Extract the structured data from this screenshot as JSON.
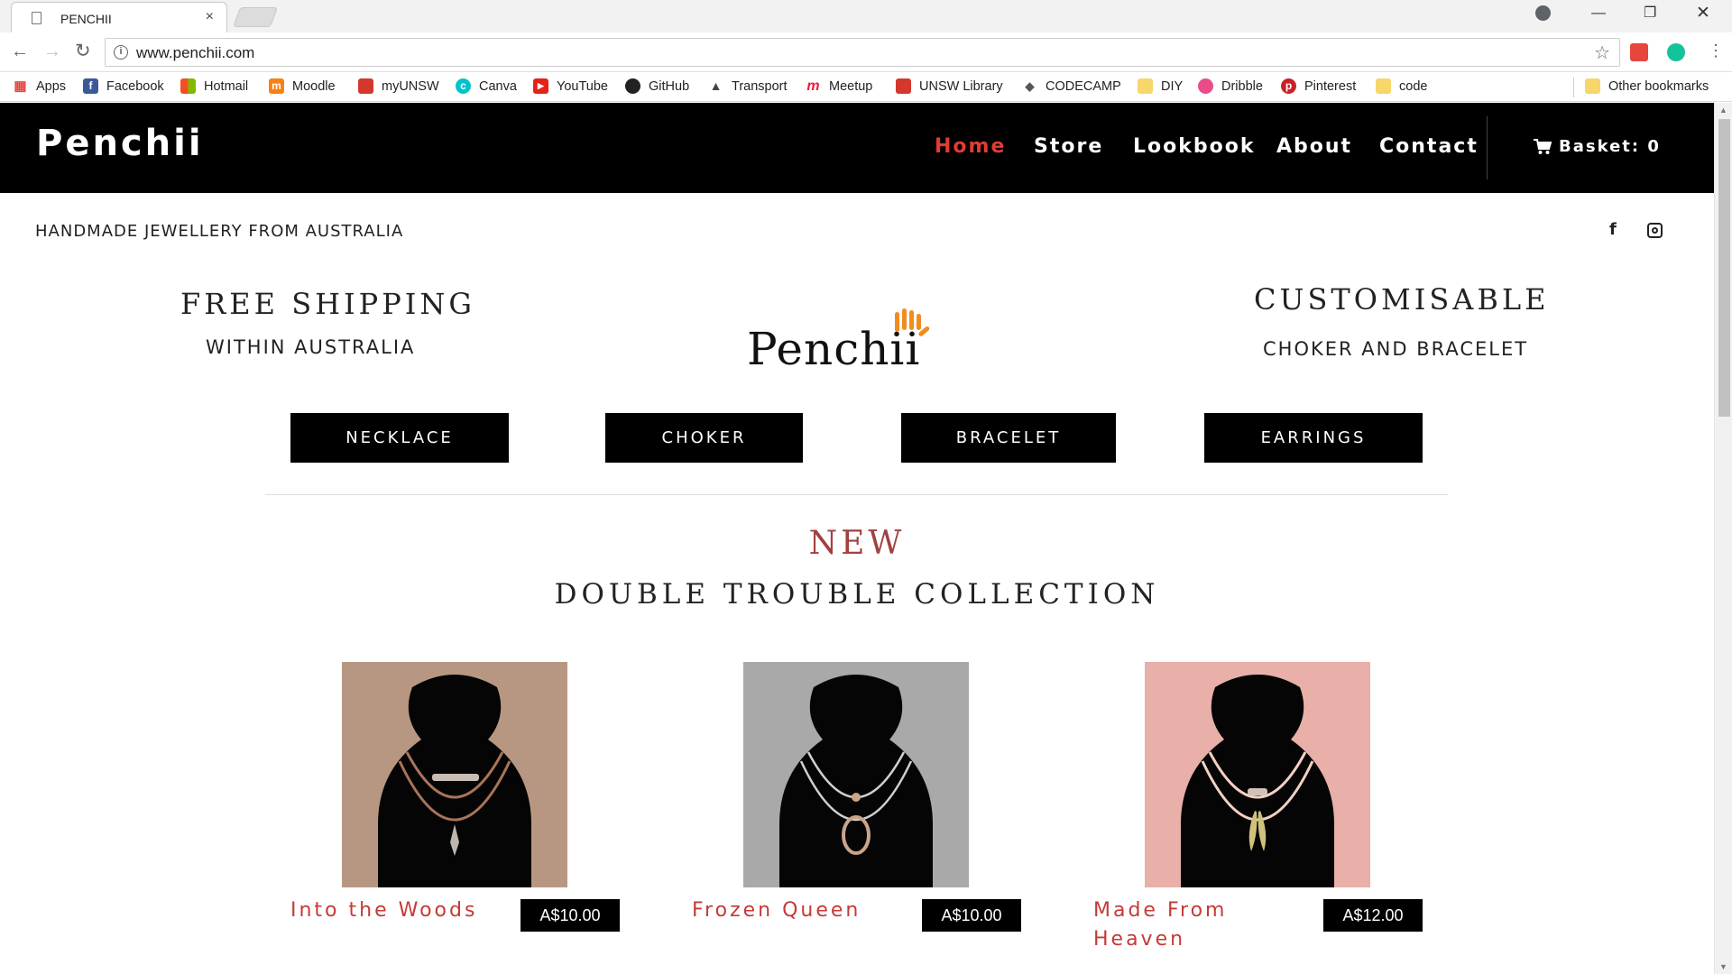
{
  "browser": {
    "tab_title": "PENCHII",
    "tab_close": "×",
    "url": "www.penchii.com",
    "bookmarks": [
      {
        "label": "Apps",
        "icon": "apps-grid-icon",
        "color": "#e8453c"
      },
      {
        "label": "Facebook",
        "icon": "facebook-icon",
        "color": "#3b5998"
      },
      {
        "label": "Hotmail",
        "icon": "windows-icon",
        "color": "#f25022"
      },
      {
        "label": "Moodle",
        "icon": "moodle-icon",
        "color": "#f98012"
      },
      {
        "label": "myUNSW",
        "icon": "unsw-crest-icon",
        "color": "#d4382c"
      },
      {
        "label": "Canva",
        "icon": "canva-icon",
        "color": "#00c4cc"
      },
      {
        "label": "YouTube",
        "icon": "youtube-icon",
        "color": "#e62117"
      },
      {
        "label": "GitHub",
        "icon": "github-icon",
        "color": "#222222"
      },
      {
        "label": "Transport",
        "icon": "transport-icon",
        "color": "#444444"
      },
      {
        "label": "Meetup",
        "icon": "meetup-icon",
        "color": "#ed1c40"
      },
      {
        "label": "UNSW Library",
        "icon": "unsw-crest-icon",
        "color": "#d4382c"
      },
      {
        "label": "CODECAMP",
        "icon": "codecamp-icon",
        "color": "#555555"
      },
      {
        "label": "DIY",
        "icon": "folder-icon",
        "color": "#f7d66a"
      },
      {
        "label": "Dribble",
        "icon": "dribbble-icon",
        "color": "#ea4c89"
      },
      {
        "label": "Pinterest",
        "icon": "pinterest-icon",
        "color": "#cb2027"
      },
      {
        "label": "code",
        "icon": "folder-icon",
        "color": "#f7d66a"
      }
    ],
    "other_bookmarks": "Other bookmarks"
  },
  "site": {
    "logo": "Penchii",
    "nav": [
      "Home",
      "Store",
      "Lookbook",
      "About",
      "Contact"
    ],
    "active_nav": "Home",
    "basket": "Basket: 0",
    "tagline": "HANDMADE JEWELLERY FROM AUSTRALIA",
    "social_facebook": "f",
    "promo_left_big": "FREE SHIPPING",
    "promo_left_small": "WITHIN AUSTRALIA",
    "promo_right_big": "CUSTOMISABLE",
    "promo_right_small": "CHOKER AND BRACELET",
    "brand_word": "Penchii",
    "categories": [
      "NECKLACE",
      "CHOKER",
      "BRACELET",
      "EARRINGS"
    ],
    "section_label": "NEW",
    "collection_title": "DOUBLE TROUBLE COLLECTION",
    "products": [
      {
        "name": "Into the Woods",
        "price": "A$10.00",
        "bg": "#b89782",
        "cord": "#a8745a"
      },
      {
        "name": "Frozen Queen",
        "price": "A$10.00",
        "bg": "#a9a9a9",
        "cord": "#cfcfcf"
      },
      {
        "name": "Made From Heaven",
        "name_line1": "Made From",
        "name_line2": "Heaven",
        "price": "A$12.00",
        "bg": "#e8b0a8",
        "cord": "#f3d0c4"
      }
    ]
  },
  "colors": {
    "accent_red": "#e23b35",
    "product_name_red": "#c53a37",
    "new_label": "#a24040",
    "logo_orange": "#f28c1c"
  }
}
